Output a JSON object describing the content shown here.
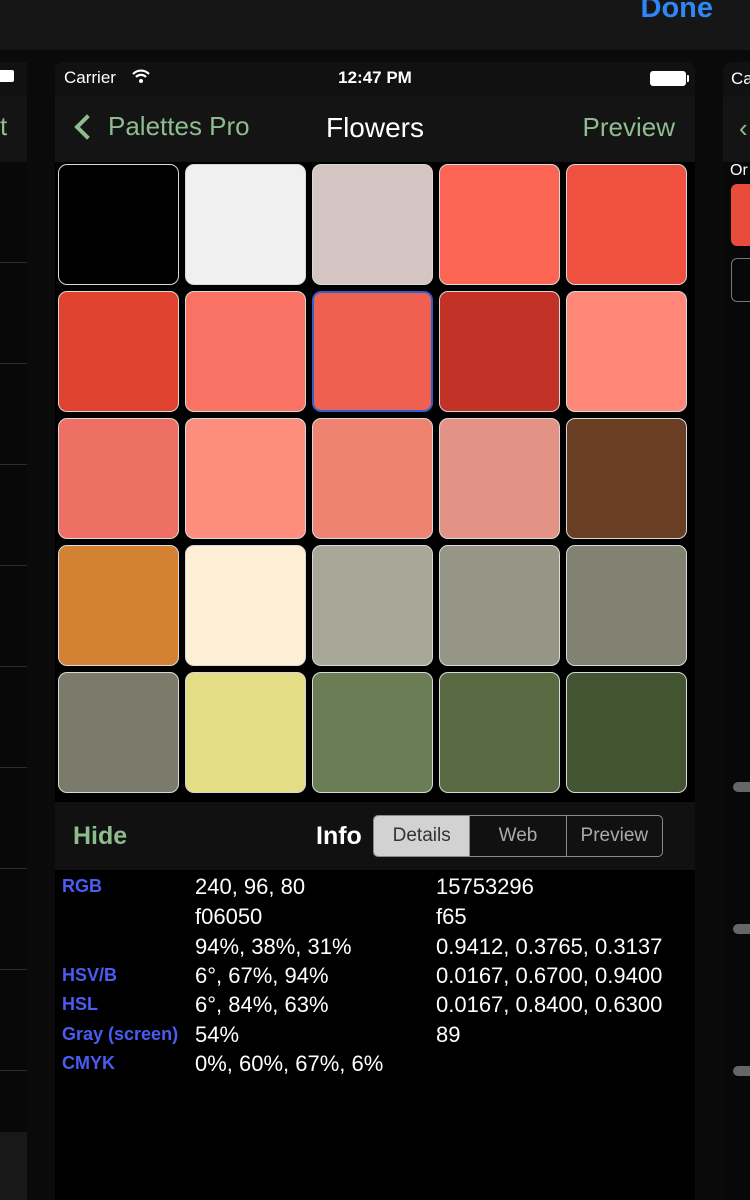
{
  "topbar": {
    "done_label": "Done"
  },
  "right_panel": {
    "carrier_partial": "Ca",
    "label_partial": "Or"
  },
  "left_panel": {
    "nav_partial": "t"
  },
  "status": {
    "carrier": "Carrier",
    "time": "12:47 PM"
  },
  "navbar": {
    "back_label": "Palettes Pro",
    "title": "Flowers",
    "preview_label": "Preview"
  },
  "swatches": [
    "#000000",
    "#f0f0f0",
    "#d4c5c3",
    "#fc6554",
    "#f05040",
    "#e04230",
    "#f97263",
    "#f06050",
    "#c33226",
    "#ff8878",
    "#ee7064",
    "#fd8d7c",
    "#ee8372",
    "#e39385",
    "#6a3e23",
    "#d38233",
    "#fdefd6",
    "#a8a898",
    "#969686",
    "#828272",
    "#7b7b6b",
    "#e3de85",
    "#6b7d54",
    "#596a43",
    "#435432"
  ],
  "selected_swatch": 7,
  "toolbar": {
    "hide_label": "Hide",
    "info_label": "Info",
    "segments": [
      "Details",
      "Web",
      "Preview"
    ],
    "active_segment": 0
  },
  "info_rows": [
    {
      "label": "RGB",
      "v1": "240, 96, 80",
      "v2": "15753296"
    },
    {
      "label": "",
      "v1": "f06050",
      "v2": "f65"
    },
    {
      "label": "",
      "v1": "94%, 38%, 31%",
      "v2": "0.9412, 0.3765, 0.3137"
    },
    {
      "label": "HSV/B",
      "v1": "6°, 67%, 94%",
      "v2": "0.0167, 0.6700, 0.9400"
    },
    {
      "label": "HSL",
      "v1": "6°, 84%, 63%",
      "v2": "0.0167, 0.8400, 0.6300"
    },
    {
      "label": "Gray (screen)",
      "v1": "54%",
      "v2": "89"
    },
    {
      "label": "CMYK",
      "v1": "0%, 60%, 67%, 6%",
      "v2": ""
    }
  ],
  "colors": {
    "accent_green": "#8fbc8f",
    "done_blue": "#2f86f6",
    "label_blue": "#4a5cf2"
  }
}
